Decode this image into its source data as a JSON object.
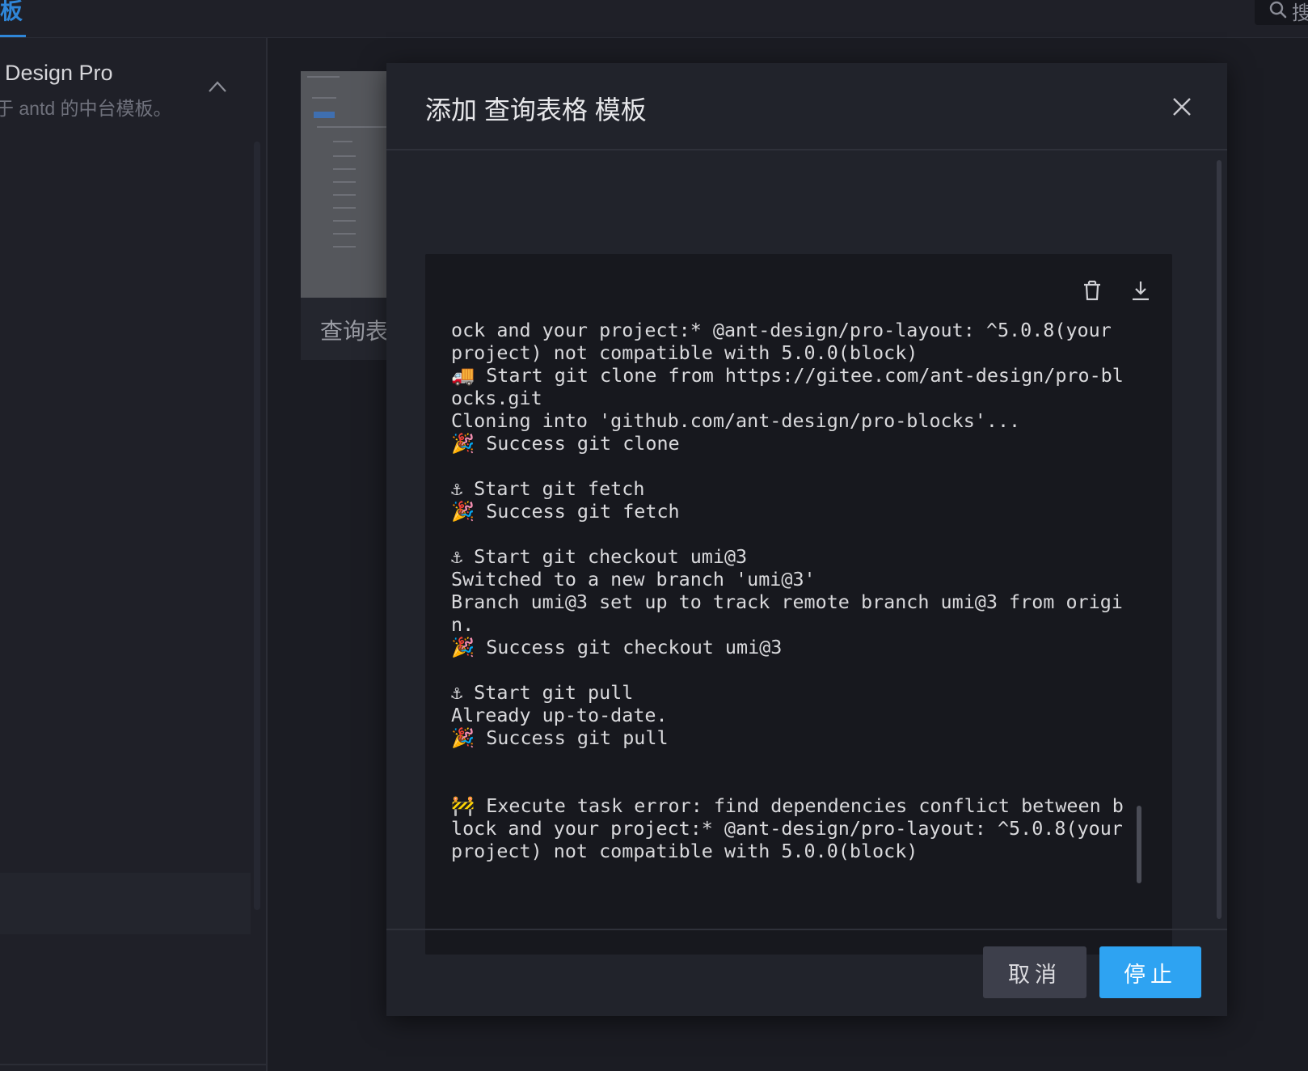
{
  "topbar": {
    "tab_label": "板",
    "search_char": "搜"
  },
  "sidebar": {
    "title": "Design Pro",
    "description": "于 antd 的中台模板。"
  },
  "card": {
    "label": "查询表格"
  },
  "modal": {
    "title": "添加 查询表格 模板",
    "log": "ock and your project:* @ant-design/pro-layout: ^5.0.8(your project) not compatible with 5.0.0(block)\n🚚 Start git clone from https://gitee.com/ant-design/pro-blocks.git\nCloning into 'github.com/ant-design/pro-blocks'...\n🎉 Success git clone\n\n⚓ Start git fetch\n🎉 Success git fetch\n\n⚓ Start git checkout umi@3\nSwitched to a new branch 'umi@3'\nBranch umi@3 set up to track remote branch umi@3 from origin.\n🎉 Success git checkout umi@3\n\n⚓ Start git pull\nAlready up-to-date.\n🎉 Success git pull\n\n\n🚧 Execute task error: find dependencies conflict between block and your project:* @ant-design/pro-layout: ^5.0.8(your project) not compatible with 5.0.0(block)",
    "cancel_label": "取消",
    "stop_label": "停止"
  },
  "icons": {
    "close": "close-icon",
    "delete": "trash-icon",
    "download": "download-icon",
    "search": "search-icon",
    "collapse": "chevron-up-icon"
  },
  "colors": {
    "primary": "#2ea3f2",
    "tab_active": "#2f86d8",
    "modal_bg": "#21232b",
    "log_bg": "#17181e"
  }
}
